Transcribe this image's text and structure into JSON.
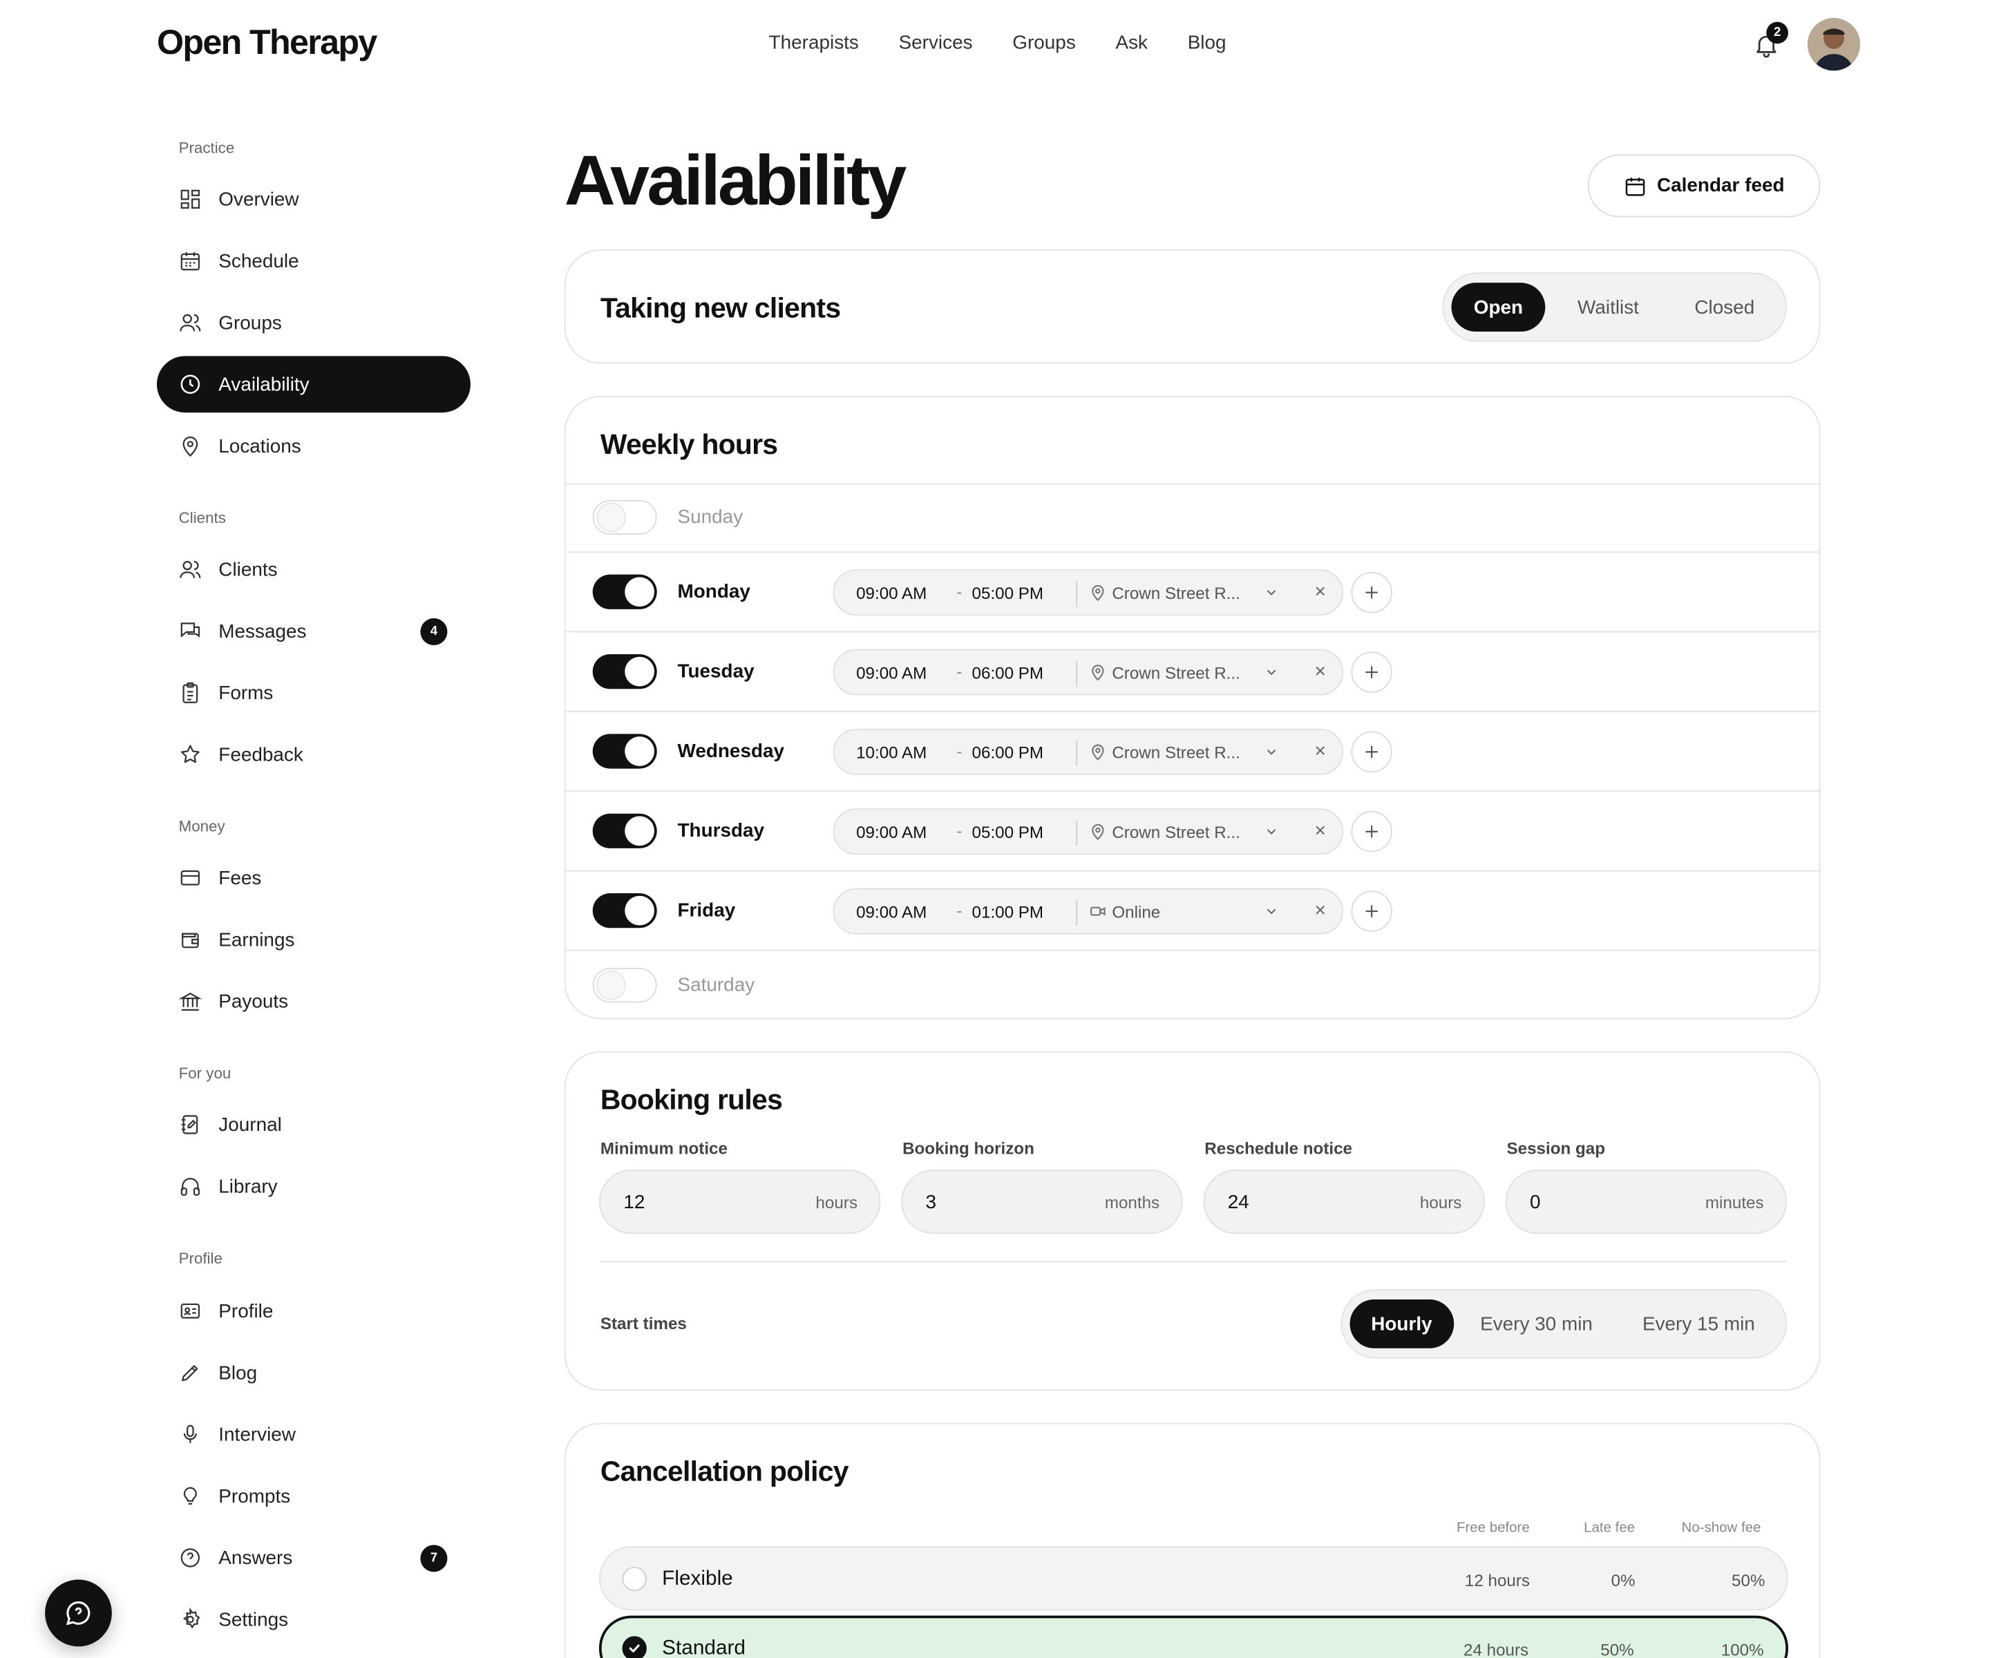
{
  "header": {
    "brand": "Open Therapy",
    "nav": [
      "Therapists",
      "Services",
      "Groups",
      "Ask",
      "Blog"
    ],
    "notifications_count": "2"
  },
  "sidebar": {
    "sections": [
      {
        "label": "Practice",
        "items": [
          {
            "label": "Overview",
            "icon": "grid-icon"
          },
          {
            "label": "Schedule",
            "icon": "calendar-icon"
          },
          {
            "label": "Groups",
            "icon": "users-icon"
          },
          {
            "label": "Availability",
            "icon": "clock-icon",
            "active": true
          },
          {
            "label": "Locations",
            "icon": "map-pin-icon"
          }
        ]
      },
      {
        "label": "Clients",
        "items": [
          {
            "label": "Clients",
            "icon": "users-icon"
          },
          {
            "label": "Messages",
            "icon": "messages-icon",
            "badge": "4"
          },
          {
            "label": "Forms",
            "icon": "clipboard-icon"
          },
          {
            "label": "Feedback",
            "icon": "star-icon"
          }
        ]
      },
      {
        "label": "Money",
        "items": [
          {
            "label": "Fees",
            "icon": "credit-card-icon"
          },
          {
            "label": "Earnings",
            "icon": "wallet-icon"
          },
          {
            "label": "Payouts",
            "icon": "bank-icon"
          }
        ]
      },
      {
        "label": "For you",
        "items": [
          {
            "label": "Journal",
            "icon": "journal-icon"
          },
          {
            "label": "Library",
            "icon": "headphones-icon"
          }
        ]
      },
      {
        "label": "Profile",
        "items": [
          {
            "label": "Profile",
            "icon": "id-card-icon"
          },
          {
            "label": "Blog",
            "icon": "pen-icon"
          },
          {
            "label": "Interview",
            "icon": "microphone-icon"
          },
          {
            "label": "Prompts",
            "icon": "lightbulb-icon"
          },
          {
            "label": "Answers",
            "icon": "help-circle-icon",
            "badge": "7"
          },
          {
            "label": "Settings",
            "icon": "gear-icon"
          }
        ]
      }
    ]
  },
  "main": {
    "title": "Availability",
    "calendar_feed": "Calendar feed",
    "taking_clients": {
      "title": "Taking new clients",
      "options": [
        "Open",
        "Waitlist",
        "Closed"
      ],
      "selected": "Open"
    },
    "weekly_hours": {
      "title": "Weekly hours",
      "days": [
        {
          "day": "Sunday",
          "enabled": false
        },
        {
          "day": "Monday",
          "enabled": true,
          "start": "09:00 AM",
          "sep": "-",
          "end": "05:00 PM",
          "location": "Crown Street R...",
          "loc_type": "map-pin-icon"
        },
        {
          "day": "Tuesday",
          "enabled": true,
          "start": "09:00 AM",
          "sep": "-",
          "end": "06:00 PM",
          "location": "Crown Street R...",
          "loc_type": "map-pin-icon"
        },
        {
          "day": "Wednesday",
          "enabled": true,
          "start": "10:00 AM",
          "sep": "-",
          "end": "06:00 PM",
          "location": "Crown Street R...",
          "loc_type": "map-pin-icon"
        },
        {
          "day": "Thursday",
          "enabled": true,
          "start": "09:00 AM",
          "sep": "-",
          "end": "05:00 PM",
          "location": "Crown Street R...",
          "loc_type": "map-pin-icon"
        },
        {
          "day": "Friday",
          "enabled": true,
          "start": "09:00 AM",
          "sep": "-",
          "end": "01:00 PM",
          "location": "Online",
          "loc_type": "video-icon"
        },
        {
          "day": "Saturday",
          "enabled": false
        }
      ]
    },
    "booking_rules": {
      "title": "Booking rules",
      "fields": [
        {
          "label": "Minimum notice",
          "value": "12",
          "unit": "hours"
        },
        {
          "label": "Booking horizon",
          "value": "3",
          "unit": "months"
        },
        {
          "label": "Reschedule notice",
          "value": "24",
          "unit": "hours"
        },
        {
          "label": "Session gap",
          "value": "0",
          "unit": "minutes"
        }
      ],
      "start_times_label": "Start times",
      "start_times": [
        "Hourly",
        "Every 30 min",
        "Every 15 min"
      ],
      "start_times_selected": "Hourly"
    },
    "cancellation": {
      "title": "Cancellation policy",
      "columns": [
        "Free before",
        "Late fee",
        "No-show fee"
      ],
      "policies": [
        {
          "name": "Flexible",
          "free_before": "12 hours",
          "late_fee": "0%",
          "no_show": "50%",
          "selected": false
        },
        {
          "name": "Standard",
          "free_before": "24 hours",
          "late_fee": "50%",
          "no_show": "100%",
          "selected": true
        }
      ]
    }
  },
  "colors": {
    "accent": "#111111",
    "selected_policy_bg": "#dff3e2",
    "badge_bg": "#111111"
  }
}
